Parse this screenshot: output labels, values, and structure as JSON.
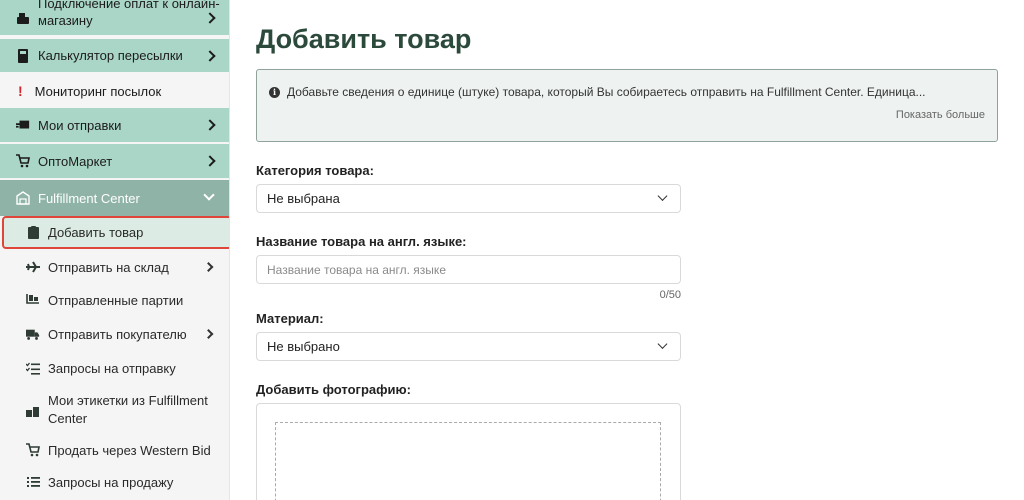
{
  "sidebar": {
    "items": [
      {
        "label": "Подключение оплат к онлайн-магазину",
        "icon": "cash-register-icon"
      },
      {
        "label": "Калькулятор пересылки",
        "icon": "calculator-icon"
      },
      {
        "label": "Мониторинг посылок",
        "icon": "exclamation-icon"
      },
      {
        "label": "Мои отправки",
        "icon": "shipping-icon"
      },
      {
        "label": "ОптоМаркет",
        "icon": "cart-icon"
      },
      {
        "label": "Fulfillment Center",
        "icon": "warehouse-icon"
      }
    ],
    "submenu": [
      {
        "label": "Добавить товар",
        "icon": "clipboard-icon"
      },
      {
        "label": "Отправить на склад",
        "icon": "plane-icon"
      },
      {
        "label": "Отправленные партии",
        "icon": "pallet-icon"
      },
      {
        "label": "Отправить покупателю",
        "icon": "truck-icon"
      },
      {
        "label": "Запросы на отправку",
        "icon": "checklist-icon"
      },
      {
        "label": "Мои этикетки из Fulfillment Center",
        "icon": "boxes-icon"
      },
      {
        "label": "Продать через Western Bid",
        "icon": "cart-plus-icon"
      },
      {
        "label": "Запросы на продажу",
        "icon": "list-icon"
      }
    ]
  },
  "main": {
    "title": "Добавить товар",
    "info": {
      "text": "Добавьте сведения о единице (штуке) товара, который Вы собираетесь отправить на Fulfillment Center. Единица...",
      "show_more": "Показать больше"
    },
    "fields": {
      "category_label": "Категория товара:",
      "category_value": "Не выбрана",
      "name_label": "Название товара на англ. языке:",
      "name_placeholder": "Название товара на англ. языке",
      "name_counter": "0/50",
      "material_label": "Материал:",
      "material_value": "Не выбрано",
      "photo_label": "Добавить фотографию:"
    }
  },
  "colors": {
    "sidebar_green": "#a9d6c6",
    "sidebar_active_header": "#8fb3a6",
    "highlight_border": "#e0453a",
    "title_color": "#2c4a3c"
  }
}
